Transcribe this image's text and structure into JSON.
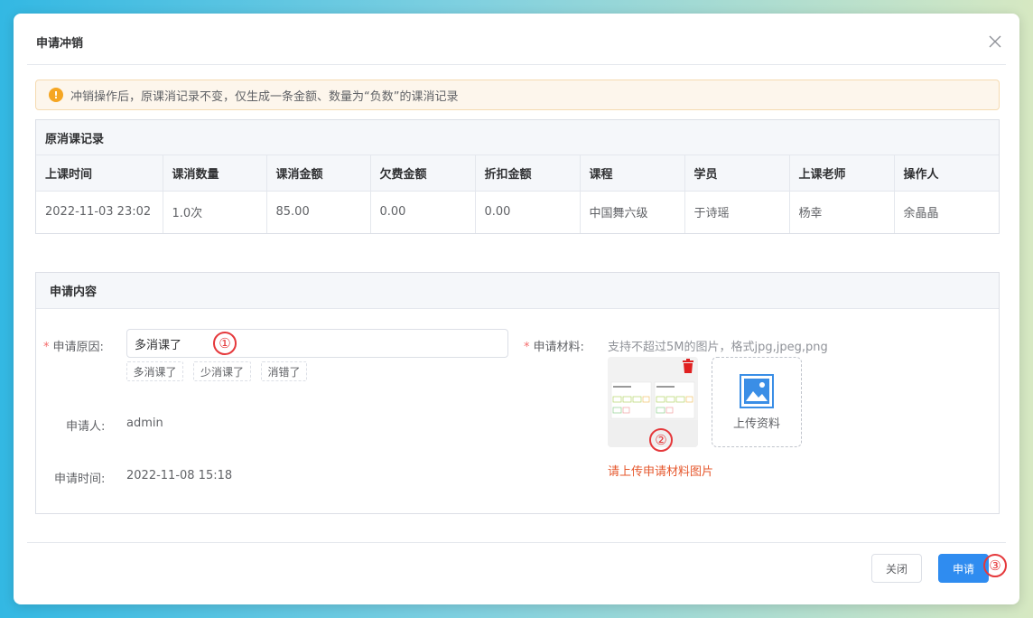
{
  "dialog": {
    "title": "申请冲销",
    "notice": "冲销操作后，原课消记录不变，仅生成一条金额、数量为“负数”的课消记录"
  },
  "record": {
    "section_title": "原消课记录",
    "headers": [
      "上课时间",
      "课消数量",
      "课消金额",
      "欠费金额",
      "折扣金额",
      "课程",
      "学员",
      "上课老师",
      "操作人"
    ],
    "row": [
      "2022-11-03 23:02",
      "1.0次",
      "85.00",
      "0.00",
      "0.00",
      "中国舞六级",
      "于诗瑶",
      "杨幸",
      "余晶晶"
    ]
  },
  "apply": {
    "section_title": "申请内容",
    "reason_label": "申请原因:",
    "reason_value": "多消课了",
    "reason_chips": [
      "多消课了",
      "少消课了",
      "消错了"
    ],
    "applicant_label": "申请人:",
    "applicant_value": "admin",
    "time_label": "申请时间:",
    "time_value": "2022-11-08 15:18",
    "material_label": "申请材料:",
    "material_hint": "支持不超过5M的图片，格式jpg,jpeg,png",
    "upload_label": "上传资料",
    "material_error": "请上传申请材料图片"
  },
  "markers": [
    "①",
    "②",
    "③"
  ],
  "buttons": {
    "close": "关闭",
    "apply": "申请"
  },
  "colors": {
    "primary": "#2f8cf0",
    "warning": "#f5a623",
    "error": "#e6582e",
    "required": "#f56c6c",
    "marker": "#e5383b"
  },
  "icons": {
    "close": "close-icon",
    "warning": "warning-icon",
    "trash": "trash-icon",
    "image": "image-icon"
  }
}
